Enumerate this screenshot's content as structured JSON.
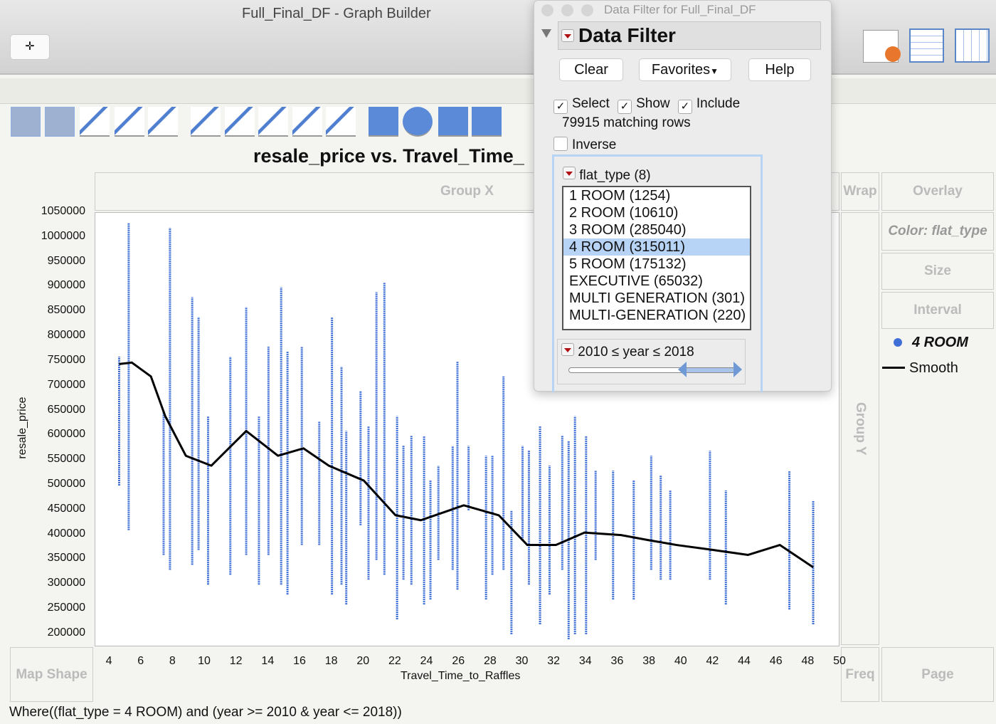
{
  "window": {
    "title": "Full_Final_DF - Graph Builder"
  },
  "toolbar": {
    "crosshair_icon": "crosshair-icon",
    "element_icons": [
      "points",
      "smoother",
      "line-of-fit",
      "ellipse",
      "contour",
      "line",
      "bar",
      "area",
      "box-plot",
      "histogram",
      "heatmap",
      "pie",
      "treemap",
      "mosaic"
    ]
  },
  "graph": {
    "title": "resale_price vs. Travel_Time_",
    "group_x": "Group X",
    "group_y": "Group Y",
    "wrap": "Wrap",
    "overlay": "Overlay",
    "color": "Color: flat_type",
    "size": "Size",
    "interval": "Interval",
    "map_shape": "Map Shape",
    "freq": "Freq",
    "page": "Page",
    "legend": [
      {
        "label": "4 ROOM",
        "color": "#3f6fd6"
      },
      {
        "label": "Smooth",
        "color": "#000000"
      }
    ],
    "where": "Where((flat_type = 4 ROOM) and (year >= 2010 & year <= 2018))"
  },
  "chart_data": {
    "type": "scatter",
    "title": "resale_price vs. Travel_Time_",
    "xlabel": "Travel_Time_to_Raffles",
    "ylabel": "resale_price",
    "xlim": [
      3.1,
      50
    ],
    "ylim": [
      174000,
      1050000
    ],
    "xticks": [
      "4",
      "6",
      "8",
      "10",
      "12",
      "14",
      "16",
      "18",
      "20",
      "22",
      "24",
      "26",
      "28",
      "30",
      "32",
      "34",
      "36",
      "38",
      "40",
      "42",
      "44",
      "46",
      "48",
      "50"
    ],
    "yticks": [
      "1050000",
      "1000000",
      "950000",
      "900000",
      "850000",
      "800000",
      "750000",
      "700000",
      "650000",
      "600000",
      "550000",
      "500000",
      "450000",
      "400000",
      "350000",
      "300000",
      "250000",
      "200000"
    ],
    "series": [
      {
        "name": "4 ROOM",
        "color": "#3f6fd6",
        "strips": [
          [
            4.6,
            500000,
            760000
          ],
          [
            5.2,
            410000,
            1030000
          ],
          [
            7.4,
            360000,
            650000
          ],
          [
            7.8,
            330000,
            1020000
          ],
          [
            9.2,
            340000,
            880000
          ],
          [
            9.6,
            370000,
            840000
          ],
          [
            10.2,
            300000,
            640000
          ],
          [
            11.6,
            320000,
            760000
          ],
          [
            12.6,
            360000,
            860000
          ],
          [
            13.4,
            300000,
            640000
          ],
          [
            14.0,
            360000,
            780000
          ],
          [
            14.8,
            300000,
            900000
          ],
          [
            15.2,
            280000,
            770000
          ],
          [
            16.1,
            380000,
            780000
          ],
          [
            17.2,
            380000,
            630000
          ],
          [
            18.0,
            280000,
            840000
          ],
          [
            18.6,
            300000,
            740000
          ],
          [
            18.9,
            260000,
            610000
          ],
          [
            19.8,
            420000,
            690000
          ],
          [
            20.3,
            310000,
            620000
          ],
          [
            20.8,
            350000,
            890000
          ],
          [
            21.3,
            320000,
            910000
          ],
          [
            22.1,
            230000,
            640000
          ],
          [
            22.5,
            310000,
            580000
          ],
          [
            23.0,
            300000,
            600000
          ],
          [
            23.8,
            260000,
            600000
          ],
          [
            24.2,
            270000,
            510000
          ],
          [
            24.7,
            350000,
            540000
          ],
          [
            25.6,
            330000,
            580000
          ],
          [
            25.9,
            290000,
            750000
          ],
          [
            26.6,
            450000,
            580000
          ],
          [
            27.7,
            270000,
            560000
          ],
          [
            28.1,
            320000,
            560000
          ],
          [
            28.8,
            330000,
            720000
          ],
          [
            29.3,
            200000,
            450000
          ],
          [
            30.0,
            390000,
            580000
          ],
          [
            30.4,
            300000,
            570000
          ],
          [
            31.1,
            220000,
            620000
          ],
          [
            31.7,
            280000,
            540000
          ],
          [
            32.5,
            330000,
            600000
          ],
          [
            32.9,
            190000,
            590000
          ],
          [
            33.3,
            200000,
            640000
          ],
          [
            34.0,
            200000,
            600000
          ],
          [
            34.6,
            350000,
            530000
          ],
          [
            35.7,
            270000,
            530000
          ],
          [
            37.0,
            270000,
            510000
          ],
          [
            38.1,
            330000,
            560000
          ],
          [
            38.7,
            310000,
            520000
          ],
          [
            39.3,
            310000,
            490000
          ],
          [
            41.8,
            310000,
            570000
          ],
          [
            42.8,
            260000,
            490000
          ],
          [
            46.8,
            250000,
            530000
          ],
          [
            48.3,
            220000,
            470000
          ]
        ]
      },
      {
        "name": "Smooth",
        "color": "#000000",
        "points": [
          [
            4.6,
            745000
          ],
          [
            5.4,
            748000
          ],
          [
            6.6,
            720000
          ],
          [
            7.5,
            640000
          ],
          [
            8.8,
            560000
          ],
          [
            10.4,
            540000
          ],
          [
            12.6,
            610000
          ],
          [
            14.6,
            560000
          ],
          [
            16.2,
            575000
          ],
          [
            17.8,
            540000
          ],
          [
            20.0,
            510000
          ],
          [
            22.0,
            440000
          ],
          [
            23.6,
            430000
          ],
          [
            26.3,
            460000
          ],
          [
            28.5,
            440000
          ],
          [
            30.3,
            380000
          ],
          [
            32.1,
            380000
          ],
          [
            33.9,
            405000
          ],
          [
            36.2,
            400000
          ],
          [
            37.9,
            390000
          ],
          [
            39.7,
            380000
          ],
          [
            42.0,
            370000
          ],
          [
            44.2,
            360000
          ],
          [
            46.2,
            380000
          ],
          [
            48.3,
            335000
          ]
        ]
      }
    ]
  },
  "filter": {
    "window_title": "Data Filter for Full_Final_DF",
    "heading": "Data Filter",
    "clear": "Clear",
    "favorites": "Favorites",
    "help": "Help",
    "select": "Select",
    "show": "Show",
    "include": "Include",
    "matching": "79915 matching rows",
    "inverse": "Inverse",
    "column": "flat_type (8)",
    "items": [
      "1 ROOM (1254)",
      "2 ROOM (10610)",
      "3 ROOM (285040)",
      "4 ROOM (315011)",
      "5 ROOM (175132)",
      "EXECUTIVE (65032)",
      "MULTI GENERATION (301)",
      "MULTI-GENERATION (220)"
    ],
    "selected": "4 ROOM (315011)",
    "range_label": "2010 ≤ year ≤ 2018",
    "range": [
      2010,
      2018
    ]
  }
}
